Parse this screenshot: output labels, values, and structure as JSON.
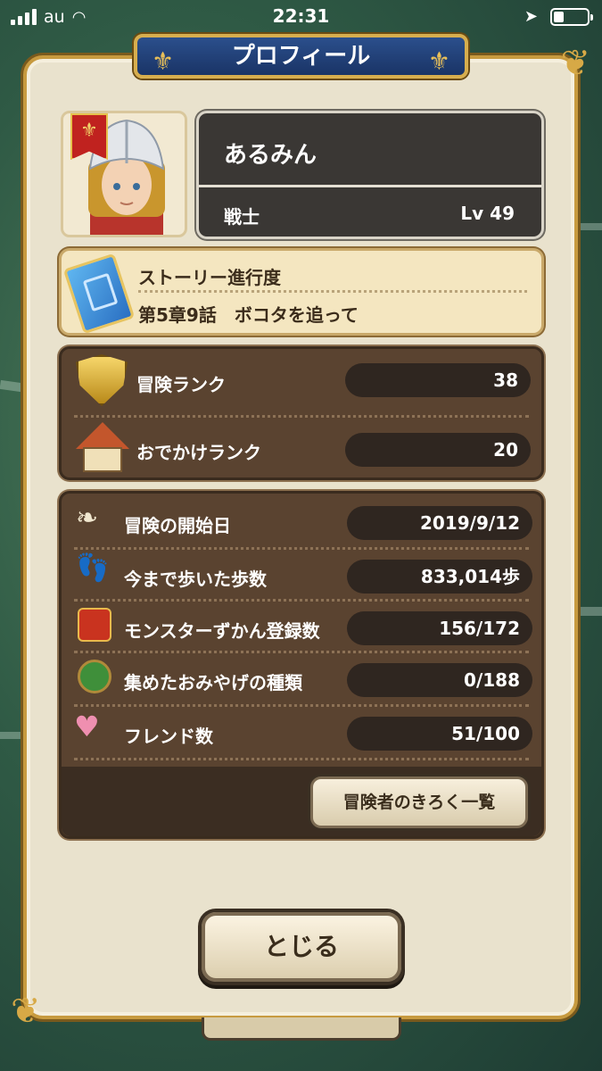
{
  "status_bar": {
    "carrier": "au",
    "time": "22:31",
    "battery_level": 0.3
  },
  "dialog": {
    "title": "プロフィール",
    "player": {
      "name": "あるみん",
      "job": "戦士",
      "level": "Lv 49"
    },
    "story": {
      "label": "ストーリー進行度",
      "value": "第5章9話　ボコタを追って"
    },
    "ranks": [
      {
        "label": "冒険ランク",
        "value": "38",
        "icon": "shield-icon"
      },
      {
        "label": "おでかけランク",
        "value": "20",
        "icon": "house-icon"
      }
    ],
    "records": [
      {
        "label": "冒険の開始日",
        "value": "2019/9/12",
        "icon": "wing-icon"
      },
      {
        "label": "今まで歩いた歩数",
        "value": "833,014歩",
        "icon": "footprints-icon"
      },
      {
        "label": "モンスターずかん登録数",
        "value": "156/172",
        "icon": "monster-book-icon"
      },
      {
        "label": "集めたおみやげの種類",
        "value": "0/188",
        "icon": "japan-map-icon"
      },
      {
        "label": "フレンド数",
        "value": "51/100",
        "icon": "handshake-icon"
      }
    ],
    "records_button": "冒険者のきろく一覧",
    "close_button": "とじる"
  }
}
